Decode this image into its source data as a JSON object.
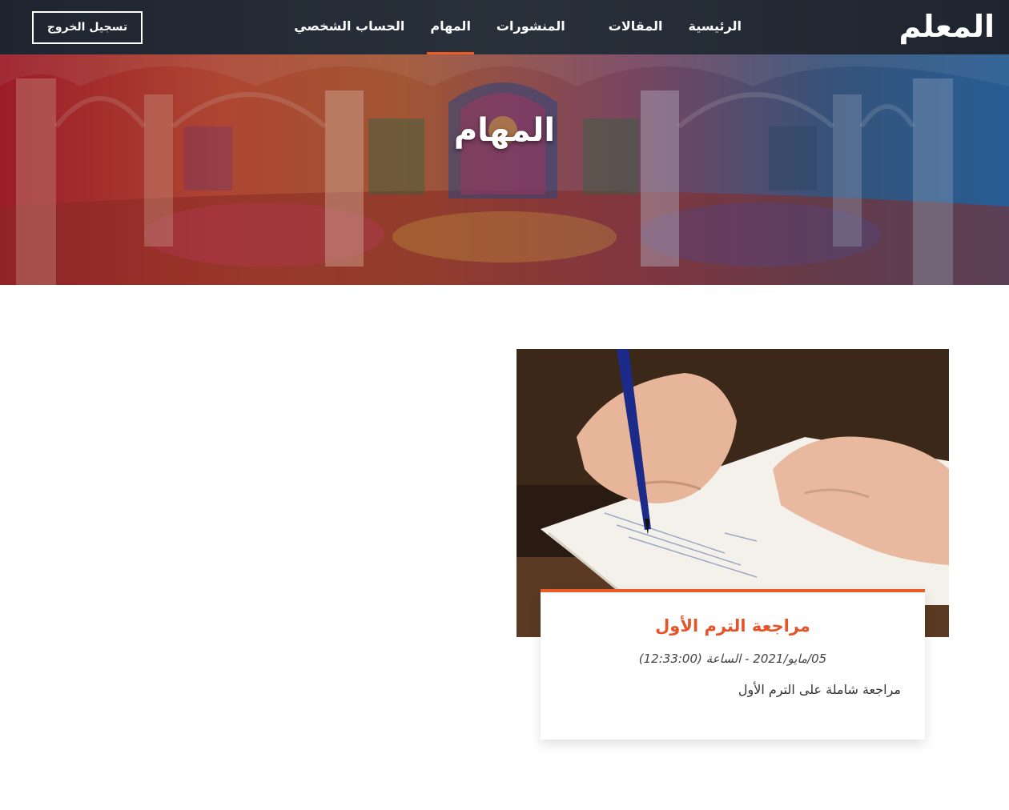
{
  "header": {
    "logo": "المعلم",
    "nav": [
      {
        "label": "الرئيسية",
        "active": false
      },
      {
        "label": "المقالات",
        "active": false
      },
      {
        "label": "المنشورات",
        "active": false
      },
      {
        "label": "المهام",
        "active": true
      },
      {
        "label": "الحساب الشخصي",
        "active": false
      }
    ],
    "logout_label": "تسجيل الخروج"
  },
  "hero": {
    "title": "المهام"
  },
  "tasks": [
    {
      "title": "مراجعة الترم الأول",
      "date": "05/مايو/2021 - الساعة (12:33:00)",
      "description": "مراجعة شاملة على الترم الأول"
    }
  ],
  "colors": {
    "accent": "#ef5a24",
    "header_bg": "#252c37",
    "title_orange": "#e5552a"
  }
}
